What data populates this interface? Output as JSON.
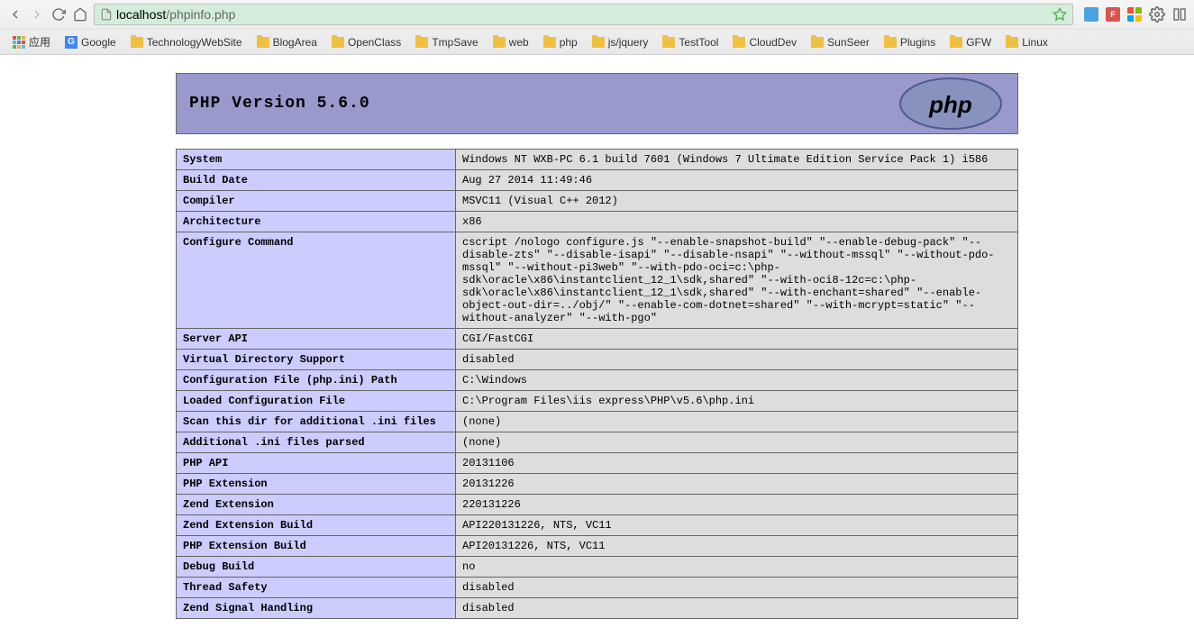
{
  "browser": {
    "url_host": "localhost",
    "url_path": "/phpinfo.php",
    "bookmarks": [
      {
        "label": "应用",
        "type": "apps"
      },
      {
        "label": "Google",
        "type": "google"
      },
      {
        "label": "TechnologyWebSite",
        "type": "folder"
      },
      {
        "label": "BlogArea",
        "type": "folder"
      },
      {
        "label": "OpenClass",
        "type": "folder"
      },
      {
        "label": "TmpSave",
        "type": "folder"
      },
      {
        "label": "web",
        "type": "folder"
      },
      {
        "label": "php",
        "type": "folder"
      },
      {
        "label": "js/jquery",
        "type": "folder"
      },
      {
        "label": "TestTool",
        "type": "folder"
      },
      {
        "label": "CloudDev",
        "type": "folder"
      },
      {
        "label": "SunSeer",
        "type": "folder"
      },
      {
        "label": "Plugins",
        "type": "folder"
      },
      {
        "label": "GFW",
        "type": "folder"
      },
      {
        "label": "Linux",
        "type": "folder"
      }
    ]
  },
  "phpinfo": {
    "title": "PHP Version 5.6.0",
    "rows": [
      {
        "key": "System",
        "val": "Windows NT WXB-PC 6.1 build 7601 (Windows 7 Ultimate Edition Service Pack 1) i586"
      },
      {
        "key": "Build Date",
        "val": "Aug 27 2014 11:49:46"
      },
      {
        "key": "Compiler",
        "val": "MSVC11 (Visual C++ 2012)"
      },
      {
        "key": "Architecture",
        "val": "x86"
      },
      {
        "key": "Configure Command",
        "val": "cscript /nologo configure.js \"--enable-snapshot-build\" \"--enable-debug-pack\" \"--disable-zts\" \"--disable-isapi\" \"--disable-nsapi\" \"--without-mssql\" \"--without-pdo-mssql\" \"--without-pi3web\" \"--with-pdo-oci=c:\\php-sdk\\oracle\\x86\\instantclient_12_1\\sdk,shared\" \"--with-oci8-12c=c:\\php-sdk\\oracle\\x86\\instantclient_12_1\\sdk,shared\" \"--with-enchant=shared\" \"--enable-object-out-dir=../obj/\" \"--enable-com-dotnet=shared\" \"--with-mcrypt=static\" \"--without-analyzer\" \"--with-pgo\""
      },
      {
        "key": "Server API",
        "val": "CGI/FastCGI"
      },
      {
        "key": "Virtual Directory Support",
        "val": "disabled"
      },
      {
        "key": "Configuration File (php.ini) Path",
        "val": "C:\\Windows"
      },
      {
        "key": "Loaded Configuration File",
        "val": "C:\\Program Files\\iis express\\PHP\\v5.6\\php.ini"
      },
      {
        "key": "Scan this dir for additional .ini files",
        "val": "(none)"
      },
      {
        "key": "Additional .ini files parsed",
        "val": "(none)"
      },
      {
        "key": "PHP API",
        "val": "20131106"
      },
      {
        "key": "PHP Extension",
        "val": "20131226"
      },
      {
        "key": "Zend Extension",
        "val": "220131226"
      },
      {
        "key": "Zend Extension Build",
        "val": "API220131226, NTS, VC11"
      },
      {
        "key": "PHP Extension Build",
        "val": "API20131226, NTS, VC11"
      },
      {
        "key": "Debug Build",
        "val": "no"
      },
      {
        "key": "Thread Safety",
        "val": "disabled"
      },
      {
        "key": "Zend Signal Handling",
        "val": "disabled"
      }
    ]
  }
}
